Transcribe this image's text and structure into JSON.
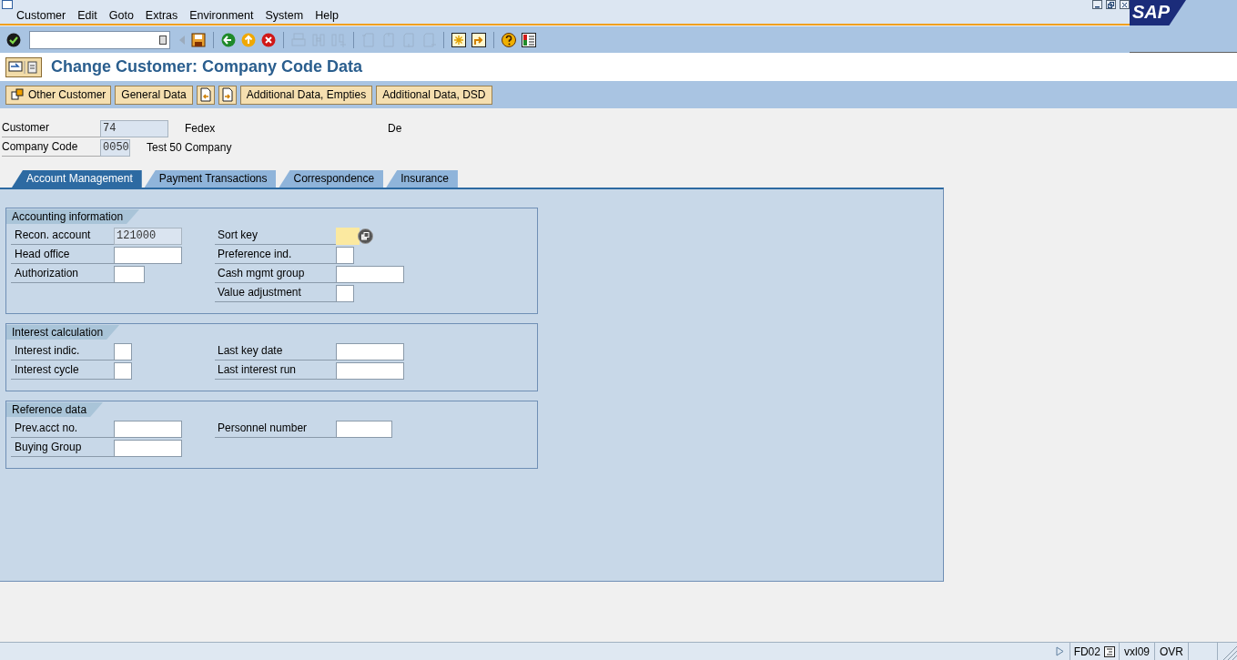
{
  "menu": [
    "Customer",
    "Edit",
    "Goto",
    "Extras",
    "Environment",
    "System",
    "Help"
  ],
  "toolbar": [
    {
      "kind": "enter",
      "disabled": false
    },
    {
      "kind": "command-field"
    },
    {
      "kind": "back-small",
      "disabled": true
    },
    {
      "kind": "save",
      "disabled": false
    },
    {
      "kind": "sep"
    },
    {
      "kind": "back",
      "disabled": false
    },
    {
      "kind": "exit",
      "disabled": false
    },
    {
      "kind": "cancel",
      "disabled": false
    },
    {
      "kind": "sep"
    },
    {
      "kind": "print",
      "disabled": true
    },
    {
      "kind": "find",
      "disabled": true
    },
    {
      "kind": "find-next",
      "disabled": true
    },
    {
      "kind": "sep"
    },
    {
      "kind": "first-page",
      "disabled": true
    },
    {
      "kind": "prev-page",
      "disabled": true
    },
    {
      "kind": "next-page",
      "disabled": true
    },
    {
      "kind": "last-page",
      "disabled": true
    },
    {
      "kind": "sep"
    },
    {
      "kind": "new-session",
      "disabled": false
    },
    {
      "kind": "shortcut",
      "disabled": false
    },
    {
      "kind": "sep"
    },
    {
      "kind": "help",
      "disabled": false
    },
    {
      "kind": "layout",
      "disabled": false
    }
  ],
  "logo": "SAP",
  "title": "Change Customer: Company Code Data",
  "app_toolbar": [
    {
      "kind": "icon-text",
      "label": "Other Customer"
    },
    {
      "kind": "text",
      "label": "General Data"
    },
    {
      "kind": "icon-prev"
    },
    {
      "kind": "icon-next"
    },
    {
      "kind": "text",
      "label": "Additional Data, Empties"
    },
    {
      "kind": "text",
      "label": "Additional Data, DSD"
    }
  ],
  "header": [
    {
      "label": "Customer",
      "value": "74",
      "text_1": "Fedex",
      "text_2": "De"
    },
    {
      "label": "Company Code",
      "value": "0050",
      "text_1": "Test 50 Company"
    }
  ],
  "tabs": [
    {
      "label": "Account Management",
      "selected": true
    },
    {
      "label": "Payment Transactions",
      "selected": false
    },
    {
      "label": "Correspondence",
      "selected": false
    },
    {
      "label": "Insurance",
      "selected": false
    }
  ],
  "groups": [
    {
      "title": "Accounting information",
      "left": [
        {
          "label": "Recon. account",
          "value": "121000",
          "readonly": true,
          "focused": false
        },
        {
          "label": "Head office",
          "readonly": false,
          "focused": false
        },
        {
          "label": "Authorization",
          "readonly": false,
          "focused": false
        }
      ],
      "right": [
        {
          "label": "Sort key",
          "readonly": false,
          "focused": true,
          "help_button": true
        },
        {
          "label": "Preference ind.",
          "readonly": false,
          "focused": false
        },
        {
          "label": "Cash mgmt group",
          "readonly": false,
          "focused": false
        },
        {
          "label": "Value adjustment",
          "readonly": false,
          "focused": false
        }
      ]
    },
    {
      "title": "Interest calculation",
      "left": [
        {
          "label": "Interest indic.",
          "readonly": false,
          "focused": false
        },
        {
          "label": "Interest cycle",
          "readonly": false,
          "focused": false
        }
      ],
      "right": [
        {
          "label": "Last key date",
          "readonly": false,
          "focused": false
        },
        {
          "label": "Last interest run",
          "readonly": false,
          "focused": false
        }
      ]
    },
    {
      "title": "Reference data",
      "left": [
        {
          "label": "Prev.acct no.",
          "readonly": false,
          "focused": false
        },
        {
          "label": "Buying Group",
          "readonly": false,
          "focused": false
        }
      ],
      "right": [
        {
          "label": "Personnel number",
          "readonly": false,
          "focused": false
        }
      ]
    }
  ],
  "status_bar": {
    "transaction": "FD02",
    "server": "vxl09",
    "mode": "OVR"
  }
}
